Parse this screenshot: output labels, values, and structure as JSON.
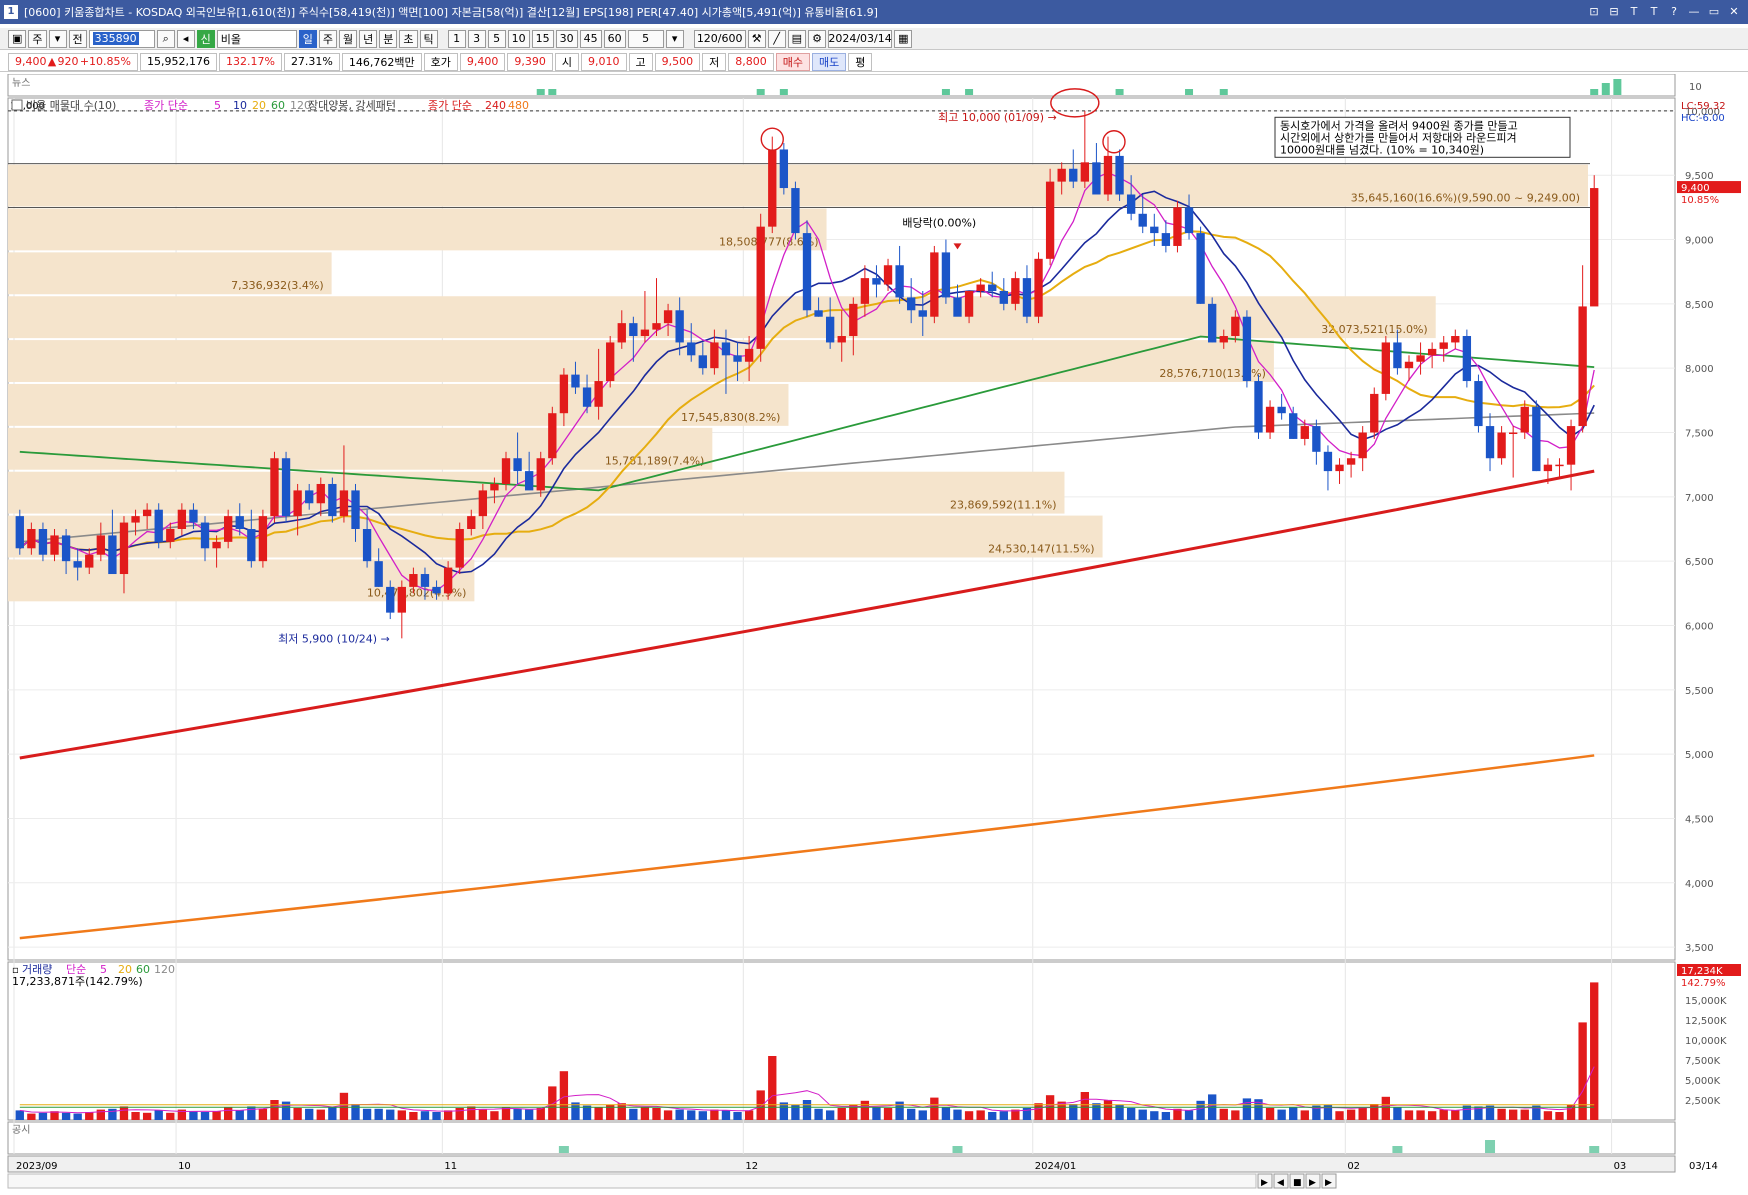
{
  "window": {
    "title": "[0600] 키움종합차트 - KOSDAQ 외국인보유[1,610(천)] 주식수[58,419(천)] 액면[100] 자본금[58(억)] 결산[12월] EPS[198] PER[47.40] 시가총액[5,491(억)] 유통비율[61.9]",
    "app_icon": "1",
    "buttons": [
      "⊡",
      "⊟",
      "Ｔ",
      "Ｔ",
      "?",
      "—",
      "▭",
      "✕"
    ]
  },
  "toolbar": {
    "type_selector": "주",
    "prev": "전",
    "code": "335890",
    "name": "비올",
    "periods": [
      "일",
      "주",
      "월",
      "년",
      "분",
      "초",
      "틱"
    ],
    "intervals": [
      "1",
      "3",
      "5",
      "10",
      "15",
      "30",
      "45",
      "60"
    ],
    "interval_value": "5",
    "count": "120/600",
    "date": "2024/03/14",
    "credit_tag": "신"
  },
  "quote": {
    "price": "9,400",
    "change_arrow": "▲",
    "change": "920",
    "change_pct": "+10.85%",
    "volume": "15,952,176",
    "volume_ratio": "132.17%",
    "turnover": "27.31%",
    "amount": "146,762백만",
    "hoga_label": "호가",
    "hoga_ask": "9,400",
    "hoga_bid": "9,390",
    "open_label": "시",
    "open": "9,010",
    "high_label": "고",
    "high": "9,500",
    "low_label": "저",
    "low": "8,800",
    "buy_btn": "매수",
    "sell_btn": "매도",
    "eval_btn": "평"
  },
  "news_panel": {
    "label": "뉴스",
    "axis_max": "10",
    "bars": [
      0,
      0,
      0,
      0,
      0,
      0,
      0,
      0,
      0,
      0,
      0,
      0,
      0,
      0,
      0,
      0,
      0,
      0,
      0,
      0,
      0,
      0,
      0,
      0,
      0,
      0,
      0,
      0,
      0,
      0,
      0,
      0,
      0,
      0,
      0,
      0,
      0,
      0,
      0,
      0,
      0,
      0,
      0,
      0,
      0,
      0,
      0,
      0,
      0,
      0,
      0,
      0,
      0,
      0,
      0,
      0,
      0,
      0,
      0,
      0,
      0,
      0,
      0,
      0,
      0,
      0,
      0,
      0,
      0,
      0,
      0,
      0,
      0,
      0,
      0,
      0,
      0,
      0,
      0,
      0,
      0,
      0,
      0,
      0,
      0,
      0,
      0,
      0,
      0,
      0,
      0,
      0,
      0,
      0,
      0,
      0,
      0,
      0,
      0,
      0,
      0,
      0,
      0,
      0,
      0,
      0,
      0,
      0,
      0,
      0,
      0,
      0,
      0,
      0,
      0,
      0,
      0,
      0,
      0,
      0,
      0,
      0,
      0,
      0,
      0,
      0,
      0,
      0,
      0,
      0,
      0,
      0,
      0,
      0,
      0,
      0,
      0,
      0,
      0,
      0,
      0,
      0,
      0,
      0,
      0,
      0,
      0,
      0,
      0,
      0,
      0,
      0,
      0,
      0,
      0,
      0,
      0,
      0,
      0,
      0,
      0,
      0,
      0,
      0,
      0,
      0,
      0,
      0,
      0,
      0,
      0,
      0,
      0,
      0,
      0,
      0,
      0,
      0,
      0,
      0,
      0,
      0,
      0,
      0,
      0,
      0,
      0,
      0,
      0,
      0,
      0,
      0,
      0,
      0,
      0,
      0,
      0,
      0,
      0,
      0,
      0,
      0,
      0,
      0,
      0,
      0,
      0,
      0,
      0,
      0,
      0,
      0,
      0,
      0,
      0,
      0,
      0,
      0,
      0,
      0,
      0,
      0,
      0,
      0,
      0,
      0,
      0,
      0,
      0,
      0,
      0,
      0,
      0,
      0,
      0,
      0,
      0,
      0,
      0,
      0,
      0,
      0,
      0,
      0,
      0,
      0,
      0,
      0,
      0,
      0,
      0,
      0,
      0,
      0,
      0,
      0,
      0,
      0,
      0
    ]
  },
  "price_panel": {
    "legend": {
      "vol_profile": "비율 매물대 수(10)",
      "ma_label": "종가 단순",
      "ma_periods": [
        "5",
        "10",
        "20",
        "60",
        "120"
      ],
      "pattern_label": "장대양봉, 강세패턴",
      "ma_long_label": "종가 단순",
      "ma_long_periods": [
        "240",
        "480"
      ]
    },
    "level_label": "10,000",
    "lc_label": "LC:59.32",
    "hc_label": "HC:-6.00",
    "price_tag": "9,400",
    "price_tag_pct": "10.85%",
    "annotations": {
      "high": "최고 10,000 (01/09)",
      "low": "최저 5,900 (10/24)",
      "dividend": "배당락(0.00%)",
      "note_lines": [
        "동시호가에서 가격을 올려서 9400원 종가를 만들고",
        "시간외에서 상한가를 만들어서 저항대와 라운드피겨",
        "10000원대를 넘겼다. (10% = 10,340원)"
      ]
    },
    "volume_profile": [
      {
        "label": "35,645,160(16.6%)(9,590.00 ~ 9,249.00)",
        "high": 9590,
        "low": 9249,
        "pct": 16.6
      },
      {
        "label": "18,508,777(8.6%)",
        "high": 9249,
        "low": 8908,
        "pct": 8.6
      },
      {
        "label": "7,336,932(3.4%)",
        "high": 8908,
        "low": 8567,
        "pct": 3.4
      },
      {
        "label": "32,073,521(15.0%)",
        "high": 8567,
        "low": 8226,
        "pct": 15.0
      },
      {
        "label": "28,576,710(13.3%)",
        "high": 8226,
        "low": 7885,
        "pct": 13.3
      },
      {
        "label": "17,545,830(8.2%)",
        "high": 7885,
        "low": 7544,
        "pct": 8.2
      },
      {
        "label": "15,781,189(7.4%)",
        "high": 7544,
        "low": 7203,
        "pct": 7.4
      },
      {
        "label": "23,869,592(11.1%)",
        "high": 7203,
        "low": 6862,
        "pct": 11.1
      },
      {
        "label": "24,530,147(11.5%)",
        "high": 6862,
        "low": 6521,
        "pct": 11.5
      },
      {
        "label": "10,476,802(4.9%)",
        "high": 6521,
        "low": 6180,
        "pct": 4.9
      }
    ],
    "y_ticks": [
      "10,000",
      "9,500",
      "9,000",
      "8,500",
      "8,000",
      "7,500",
      "7,000",
      "6,500",
      "6,000",
      "5,500",
      "5,000",
      "4,500",
      "4,000",
      "3,500"
    ]
  },
  "volume_panel": {
    "legend": {
      "label": "거래량",
      "ma_label": "단순",
      "periods": [
        "5",
        "20",
        "60",
        "120"
      ]
    },
    "last_volume": "17,233,871주(142.79%)",
    "tag": "17,234K",
    "tag_pct": "142.79%",
    "y_ticks": [
      "15,000K",
      "12,500K",
      "10,000K",
      "7,500K",
      "5,000K",
      "2,500K"
    ]
  },
  "disclosure_panel": {
    "label": "공시"
  },
  "x_axis": {
    "labels": [
      "2023/09",
      "10",
      "11",
      "12",
      "2024/01",
      "02",
      "03"
    ],
    "right_label": "03/14"
  },
  "colors": {
    "up": "#e21b1b",
    "down": "#1b55c8",
    "ma5": "#d21fc8",
    "ma10": "#1b2a9c",
    "ma20": "#e6ad10",
    "ma60": "#2a9a3a",
    "ma120": "#8a8a8a",
    "ma240": "#d81c1c",
    "ma480": "#f07a1a",
    "profile": "#f5e4cc"
  },
  "chart_data": {
    "type": "candlestick",
    "title": "",
    "ylim": [
      3400,
      10100
    ],
    "candles": [
      [
        6850,
        6900,
        6550,
        6600
      ],
      [
        6600,
        6800,
        6550,
        6750
      ],
      [
        6750,
        6800,
        6500,
        6550
      ],
      [
        6550,
        6750,
        6500,
        6700
      ],
      [
        6700,
        6750,
        6400,
        6500
      ],
      [
        6500,
        6600,
        6350,
        6450
      ],
      [
        6450,
        6600,
        6400,
        6550
      ],
      [
        6550,
        6800,
        6500,
        6700
      ],
      [
        6700,
        6900,
        6550,
        6400
      ],
      [
        6400,
        6850,
        6250,
        6800
      ],
      [
        6800,
        6900,
        6700,
        6850
      ],
      [
        6850,
        6950,
        6750,
        6900
      ],
      [
        6900,
        6950,
        6600,
        6650
      ],
      [
        6650,
        6800,
        6600,
        6750
      ],
      [
        6750,
        6950,
        6700,
        6900
      ],
      [
        6900,
        6950,
        6750,
        6800
      ],
      [
        6800,
        6850,
        6500,
        6600
      ],
      [
        6600,
        6700,
        6450,
        6650
      ],
      [
        6650,
        6900,
        6600,
        6850
      ],
      [
        6850,
        6950,
        6700,
        6750
      ],
      [
        6750,
        6900,
        6450,
        6500
      ],
      [
        6500,
        6900,
        6450,
        6850
      ],
      [
        6850,
        7350,
        6800,
        7300
      ],
      [
        7300,
        7350,
        6800,
        6850
      ],
      [
        6850,
        7100,
        6700,
        7050
      ],
      [
        7050,
        7100,
        6900,
        6950
      ],
      [
        6950,
        7150,
        6850,
        7100
      ],
      [
        7100,
        7150,
        6800,
        6850
      ],
      [
        6850,
        7400,
        6800,
        7050
      ],
      [
        7050,
        7100,
        6650,
        6750
      ],
      [
        6750,
        6900,
        6450,
        6500
      ],
      [
        6500,
        6600,
        6300,
        6300
      ],
      [
        6300,
        6350,
        6050,
        6100
      ],
      [
        6100,
        6350,
        5900,
        6300
      ],
      [
        6300,
        6450,
        6250,
        6400
      ],
      [
        6400,
        6450,
        6200,
        6300
      ],
      [
        6300,
        6350,
        6200,
        6250
      ],
      [
        6250,
        6500,
        6200,
        6450
      ],
      [
        6450,
        6800,
        6400,
        6750
      ],
      [
        6750,
        6900,
        6700,
        6850
      ],
      [
        6850,
        7100,
        6750,
        7050
      ],
      [
        7050,
        7150,
        6950,
        7100
      ],
      [
        7100,
        7350,
        7050,
        7300
      ],
      [
        7300,
        7500,
        7100,
        7200
      ],
      [
        7200,
        7350,
        7100,
        7050
      ],
      [
        7050,
        7350,
        7000,
        7300
      ],
      [
        7300,
        7700,
        7250,
        7650
      ],
      [
        7650,
        8000,
        7550,
        7950
      ],
      [
        7950,
        8050,
        7800,
        7850
      ],
      [
        7850,
        7950,
        7650,
        7700
      ],
      [
        7700,
        8150,
        7600,
        7900
      ],
      [
        7900,
        8250,
        7850,
        8200
      ],
      [
        8200,
        8450,
        8150,
        8350
      ],
      [
        8350,
        8400,
        8050,
        8250
      ],
      [
        8250,
        8600,
        8200,
        8300
      ],
      [
        8300,
        8700,
        8250,
        8350
      ],
      [
        8350,
        8500,
        8250,
        8450
      ],
      [
        8450,
        8550,
        8100,
        8200
      ],
      [
        8200,
        8350,
        8050,
        8100
      ],
      [
        8100,
        8200,
        7950,
        8000
      ],
      [
        8000,
        8300,
        7950,
        8200
      ],
      [
        8200,
        8300,
        7800,
        8100
      ],
      [
        8100,
        8200,
        7900,
        8050
      ],
      [
        8050,
        8250,
        7900,
        8150
      ],
      [
        8150,
        9200,
        8050,
        9100
      ],
      [
        9100,
        9800,
        9050,
        9700
      ],
      [
        9700,
        9750,
        9350,
        9400
      ],
      [
        9400,
        9450,
        9000,
        9050
      ],
      [
        9050,
        9150,
        8400,
        8450
      ],
      [
        8450,
        8550,
        8400,
        8400
      ],
      [
        8400,
        8550,
        8150,
        8200
      ],
      [
        8200,
        8450,
        8050,
        8250
      ],
      [
        8250,
        8550,
        8100,
        8500
      ],
      [
        8500,
        8800,
        8400,
        8700
      ],
      [
        8700,
        8800,
        8550,
        8650
      ],
      [
        8650,
        8850,
        8600,
        8800
      ],
      [
        8800,
        8950,
        8500,
        8550
      ],
      [
        8550,
        8700,
        8350,
        8450
      ],
      [
        8450,
        8600,
        8250,
        8400
      ],
      [
        8400,
        8950,
        8350,
        8900
      ],
      [
        8900,
        9000,
        8500,
        8550
      ],
      [
        8550,
        8650,
        8450,
        8400
      ],
      [
        8400,
        8550,
        8350,
        8600
      ],
      [
        8600,
        8700,
        8550,
        8650
      ],
      [
        8650,
        8750,
        8550,
        8600
      ],
      [
        8600,
        8700,
        8450,
        8500
      ],
      [
        8500,
        8750,
        8450,
        8700
      ],
      [
        8700,
        8800,
        8350,
        8400
      ],
      [
        8400,
        8900,
        8350,
        8850
      ],
      [
        8850,
        9550,
        8800,
        9450
      ],
      [
        9450,
        9600,
        9350,
        9550
      ],
      [
        9550,
        9700,
        9400,
        9450
      ],
      [
        9450,
        10000,
        9400,
        9600
      ],
      [
        9600,
        9750,
        9450,
        9350
      ],
      [
        9350,
        9800,
        9300,
        9650
      ],
      [
        9650,
        9700,
        9300,
        9350
      ],
      [
        9350,
        9500,
        9150,
        9200
      ],
      [
        9200,
        9350,
        9050,
        9100
      ],
      [
        9100,
        9200,
        8950,
        9050
      ],
      [
        9050,
        9150,
        8900,
        8950
      ],
      [
        8950,
        9300,
        8900,
        9250
      ],
      [
        9250,
        9350,
        9000,
        9050
      ],
      [
        9050,
        9100,
        8500,
        8500
      ],
      [
        8500,
        8550,
        8200,
        8200
      ],
      [
        8200,
        8300,
        8150,
        8250
      ],
      [
        8250,
        8450,
        8200,
        8400
      ],
      [
        8400,
        8450,
        7850,
        7900
      ],
      [
        7900,
        7950,
        7450,
        7500
      ],
      [
        7500,
        7750,
        7450,
        7700
      ],
      [
        7700,
        7800,
        7600,
        7650
      ],
      [
        7650,
        7700,
        7450,
        7450
      ],
      [
        7450,
        7600,
        7400,
        7550
      ],
      [
        7550,
        7600,
        7250,
        7350
      ],
      [
        7350,
        7400,
        7050,
        7200
      ],
      [
        7200,
        7300,
        7100,
        7250
      ],
      [
        7250,
        7350,
        7150,
        7300
      ],
      [
        7300,
        7550,
        7200,
        7500
      ],
      [
        7500,
        7850,
        7450,
        7800
      ],
      [
        7800,
        8250,
        7750,
        8200
      ],
      [
        8200,
        8300,
        7950,
        8000
      ],
      [
        8000,
        8100,
        7900,
        8050
      ],
      [
        8050,
        8200,
        7950,
        8100
      ],
      [
        8100,
        8200,
        8000,
        8150
      ],
      [
        8150,
        8250,
        8050,
        8200
      ],
      [
        8200,
        8300,
        8150,
        8250
      ],
      [
        8250,
        8300,
        7850,
        7900
      ],
      [
        7900,
        7950,
        7500,
        7550
      ],
      [
        7550,
        7650,
        7200,
        7300
      ],
      [
        7300,
        7550,
        7250,
        7500
      ],
      [
        7500,
        7550,
        7150,
        7500
      ],
      [
        7500,
        7750,
        7450,
        7700
      ],
      [
        7700,
        7750,
        7200,
        7200
      ],
      [
        7200,
        7300,
        7100,
        7250
      ],
      [
        7250,
        7300,
        7150,
        7250
      ],
      [
        7250,
        7600,
        7050,
        7550
      ],
      [
        7550,
        8800,
        7500,
        8480
      ],
      [
        8480,
        9500,
        8800,
        9400
      ]
    ],
    "volumes": [
      1.2,
      0.8,
      0.9,
      1.1,
      0.9,
      0.8,
      1.0,
      1.3,
      1.4,
      1.7,
      1.0,
      0.9,
      1.2,
      0.9,
      1.3,
      1.1,
      1.0,
      1.1,
      1.6,
      1.2,
      1.7,
      1.4,
      2.5,
      2.3,
      1.5,
      1.4,
      1.3,
      1.6,
      3.4,
      2.0,
      1.4,
      1.4,
      1.3,
      1.2,
      1.0,
      1.1,
      1.0,
      1.2,
      1.5,
      1.7,
      1.3,
      1.1,
      1.6,
      1.4,
      1.3,
      1.5,
      4.2,
      6.1,
      2.2,
      1.8,
      1.6,
      1.9,
      2.1,
      1.4,
      1.6,
      1.5,
      1.2,
      1.3,
      1.2,
      1.1,
      1.3,
      1.2,
      1.0,
      1.2,
      3.7,
      8.0,
      2.2,
      1.9,
      2.5,
      1.4,
      1.2,
      1.5,
      1.9,
      2.4,
      1.6,
      1.5,
      2.3,
      1.4,
      1.2,
      2.8,
      1.6,
      1.3,
      1.1,
      1.2,
      1.0,
      1.1,
      1.3,
      1.5,
      2.1,
      3.1,
      2.3,
      2.0,
      3.5,
      2.1,
      2.5,
      1.9,
      1.5,
      1.3,
      1.1,
      1.0,
      1.4,
      1.2,
      2.4,
      3.2,
      1.4,
      1.2,
      2.7,
      2.6,
      1.5,
      1.3,
      1.6,
      1.2,
      1.8,
      1.9,
      1.1,
      1.3,
      1.5,
      2.0,
      2.9,
      1.6,
      1.2,
      1.2,
      1.1,
      1.3,
      1.2,
      1.8,
      1.7,
      1.8,
      1.4,
      1.3,
      1.3,
      1.8,
      1.1,
      1.0,
      1.9,
      12.2,
      17.2
    ],
    "ma240": {
      "start": 4970,
      "end": 7200
    },
    "ma480": {
      "start": 3570,
      "end": 4990
    }
  }
}
